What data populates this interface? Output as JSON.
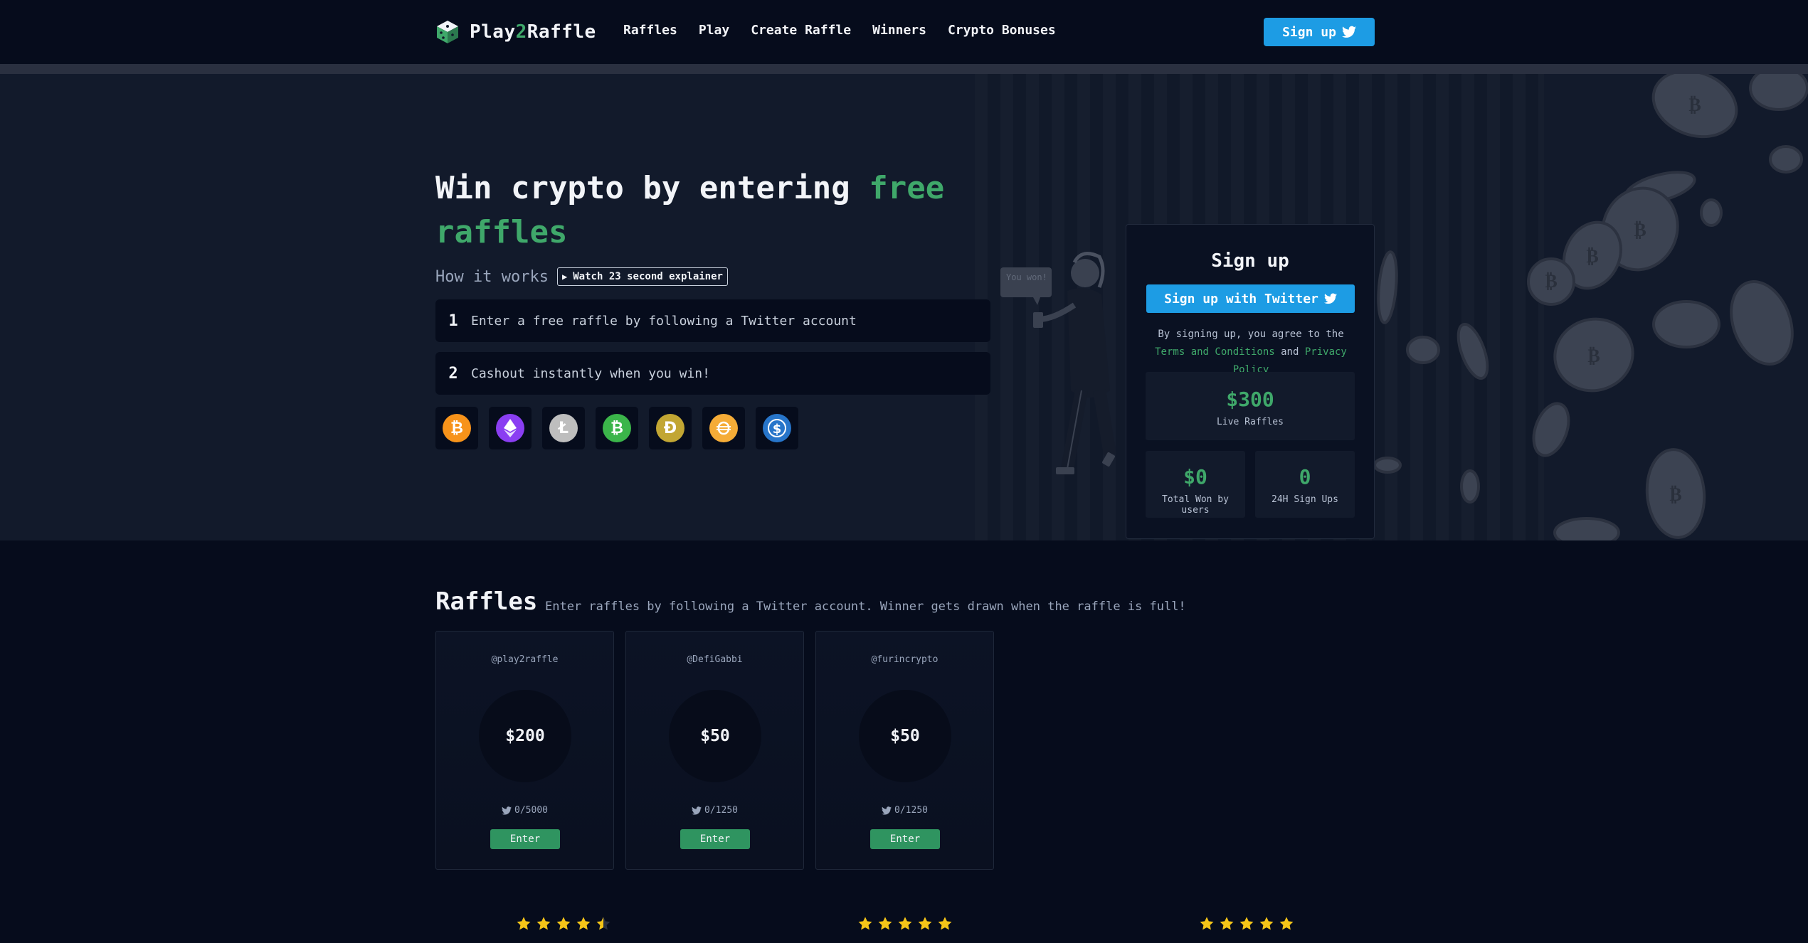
{
  "nav": {
    "logo_prefix": "Play",
    "logo_mid": "2",
    "logo_suffix": "Raffle",
    "links": [
      "Raffles",
      "Play",
      "Create Raffle",
      "Winners",
      "Crypto Bonuses"
    ],
    "signup_label": "Sign up"
  },
  "hero": {
    "title_plain": "Win crypto by entering ",
    "title_highlight": "free raffles",
    "how_it_works": "How it works",
    "watch_label": "Watch 23 second explainer",
    "steps": [
      {
        "num": "1",
        "text": "Enter a free raffle by following a Twitter account"
      },
      {
        "num": "2",
        "text": "Cashout instantly when you win!"
      }
    ],
    "coins": [
      {
        "icon": "bitcoin-icon",
        "color": "#f7931a"
      },
      {
        "icon": "ethereum-icon",
        "color": "#8a3ef2"
      },
      {
        "icon": "litecoin-icon",
        "color": "#bebebe"
      },
      {
        "icon": "bitcoin-cash-icon",
        "color": "#3bb54a"
      },
      {
        "icon": "dogecoin-icon",
        "color": "#c2a633"
      },
      {
        "icon": "dai-icon",
        "color": "#f5ac37"
      },
      {
        "icon": "usd-coin-icon",
        "color": "#2775ca"
      }
    ],
    "bubble_text": "You won!"
  },
  "signup": {
    "title": "Sign up",
    "twitter_button": "Sign up with Twitter",
    "terms_prefix": "By signing up, you agree to the ",
    "terms_link": "Terms and Conditions",
    "terms_and": " and ",
    "privacy_link": "Privacy Policy",
    "stats": {
      "live_value": "$300",
      "live_label": "Live Raffles",
      "won_value": "$0",
      "won_label": "Total Won by users",
      "signups_value": "0",
      "signups_label": "24H Sign Ups"
    }
  },
  "raffles": {
    "title": "Raffles",
    "subtitle": "Enter raffles by following a Twitter account. Winner gets drawn when the raffle is full!",
    "items": [
      {
        "handle": "@play2raffle",
        "amount": "$200",
        "count": "0/5000",
        "enter": "Enter"
      },
      {
        "handle": "@DefiGabbi",
        "amount": "$50",
        "count": "0/1250",
        "enter": "Enter"
      },
      {
        "handle": "@furincrypto",
        "amount": "$50",
        "count": "0/1250",
        "enter": "Enter"
      }
    ]
  },
  "reviews": {
    "ratings": [
      4.5,
      5,
      5
    ],
    "star_color": "#f5c518"
  }
}
